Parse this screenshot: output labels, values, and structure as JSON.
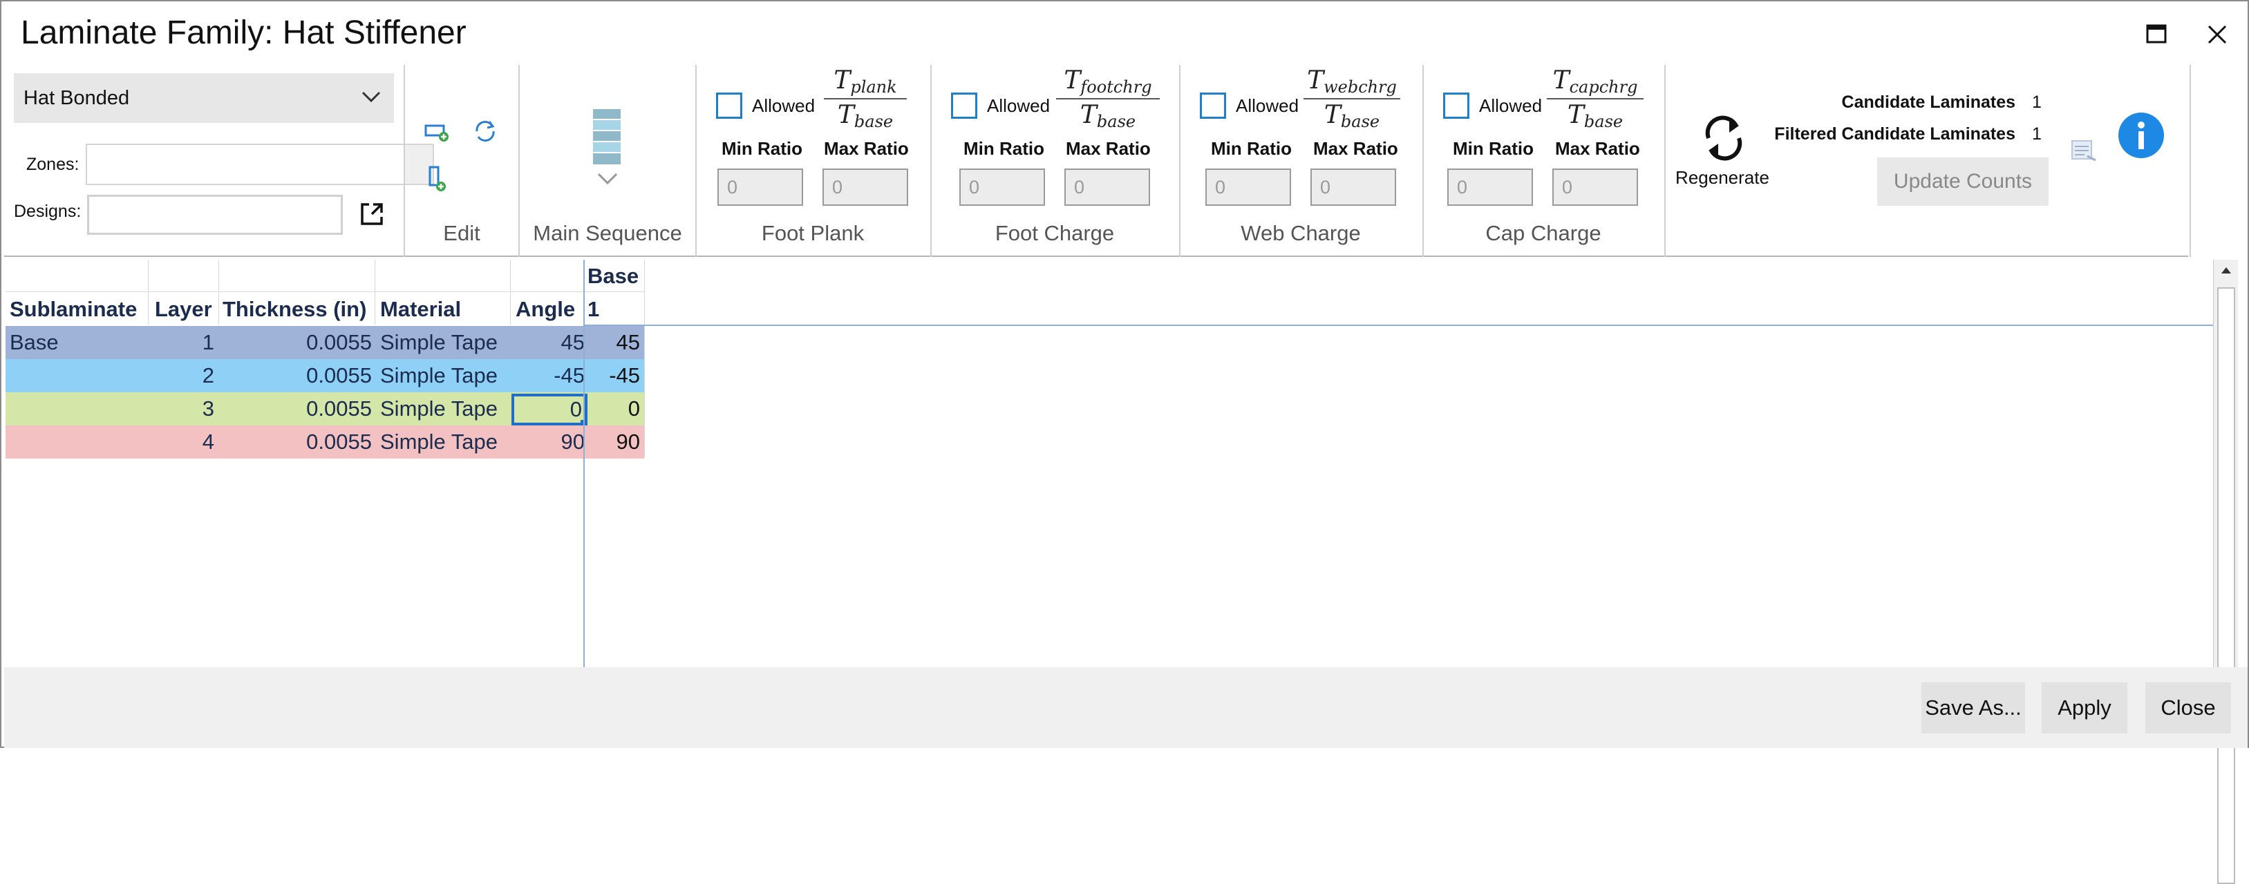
{
  "window": {
    "title": "Laminate Family: Hat Stiffener"
  },
  "ribbon": {
    "family_type": {
      "selected": "Hat Bonded"
    },
    "zones_label": "Zones:",
    "designs_label": "Designs:",
    "groups": {
      "edit": "Edit",
      "main_sequence": "Main Sequence",
      "foot_plank": "Foot Plank",
      "foot_charge": "Foot Charge",
      "web_charge": "Web Charge",
      "cap_charge": "Cap Charge"
    },
    "ratio_groups": [
      {
        "allowed_label": "Allowed",
        "num_main": "T",
        "num_sub": "plank",
        "den_main": "T",
        "den_sub": "base",
        "min_label": "Min Ratio",
        "max_label": "Max Ratio",
        "min_placeholder": "0",
        "max_placeholder": "0"
      },
      {
        "allowed_label": "Allowed",
        "num_main": "T",
        "num_sub": "footchrg",
        "den_main": "T",
        "den_sub": "base",
        "min_label": "Min Ratio",
        "max_label": "Max Ratio",
        "min_placeholder": "0",
        "max_placeholder": "0"
      },
      {
        "allowed_label": "Allowed",
        "num_main": "T",
        "num_sub": "webchrg",
        "den_main": "T",
        "den_sub": "base",
        "min_label": "Min Ratio",
        "max_label": "Max Ratio",
        "min_placeholder": "0",
        "max_placeholder": "0"
      },
      {
        "allowed_label": "Allowed",
        "num_main": "T",
        "num_sub": "capchrg",
        "den_main": "T",
        "den_sub": "base",
        "min_label": "Min Ratio",
        "max_label": "Max Ratio",
        "min_placeholder": "0",
        "max_placeholder": "0"
      }
    ],
    "regenerate_label": "Regenerate",
    "counts": {
      "candidate_label": "Candidate Laminates",
      "candidate_value": "1",
      "filtered_label": "Filtered Candidate Laminates",
      "filtered_value": "1"
    },
    "update_counts_label": "Update Counts"
  },
  "grid": {
    "top_headers": [
      "Base"
    ],
    "headers": [
      "Sublaminate",
      "Layer",
      "Thickness (in)",
      "Material",
      "Angle",
      "1"
    ],
    "rows": [
      {
        "sublaminate": "Base",
        "layer": "1",
        "thickness": "0.0055",
        "material": "Simple Tape",
        "angle": "45",
        "base1": "45",
        "color": "#9fb2d8"
      },
      {
        "sublaminate": "",
        "layer": "2",
        "thickness": "0.0055",
        "material": "Simple Tape",
        "angle": "-45",
        "base1": "-45",
        "color": "#8fd0f7"
      },
      {
        "sublaminate": "",
        "layer": "3",
        "thickness": "0.0055",
        "material": "Simple Tape",
        "angle": "0",
        "base1": "0",
        "color": "#d4e6a8"
      },
      {
        "sublaminate": "",
        "layer": "4",
        "thickness": "0.0055",
        "material": "Simple Tape",
        "angle": "90",
        "base1": "90",
        "color": "#f3c1c1"
      }
    ]
  },
  "footer": {
    "save_as": "Save As...",
    "apply": "Apply",
    "close": "Close"
  },
  "colors": {
    "accent": "#1f7fc7",
    "info": "#1e88e5"
  }
}
